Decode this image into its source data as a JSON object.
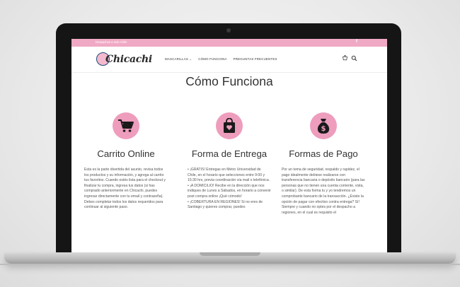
{
  "topbar": {
    "message": "Despachos a todo Chile",
    "social": "f"
  },
  "brand": {
    "name": "Chicachi"
  },
  "nav": {
    "items": [
      {
        "label": "MASCARILLAS ⌄"
      },
      {
        "label": "CÓMO FUNCIONA"
      },
      {
        "label": "PREGUNTAS FRECUENTES"
      }
    ]
  },
  "page": {
    "title": "Cómo Funciona"
  },
  "features": [
    {
      "icon": "shopping-cart-icon",
      "title": "Carrito Online",
      "text": "Esta es la parte divertida del asunto, revisa todos los productos y su información, y agrega al carrito tus favoritos. Cuando estés lista para el checkout y finalizar tu compra, ingresa tus datos (si has comprado anteriormente en Chicachi, puedes ingresar directamente con tu email y contraseña). Debes completar todos los datos requeridos para continuar al siguiente paso."
    },
    {
      "icon": "shopping-bag-heart-icon",
      "title": "Forma de Entrega",
      "items": [
        "¡GRATIS! Entregas en Metro Universidad de Chile, en el horario que selecciones entre 9:00 y 15:30 hrs, previa coordinación vía mail o telefónica.",
        "¡A DOMICILIO! Recibe en la dirección que nos indiques de Lunes a Sábados, en horario a convenir post compra online ¡Qué cómodo!",
        "¡COBERTURA EN REGIONES! Si no eres de Santiago y quieres comprar, puedes"
      ]
    },
    {
      "icon": "money-bag-icon",
      "title": "Formas de Pago",
      "text": "Por un tema de seguridad, respaldo y rapidez, el pago idealmente debiese realizarse con transferencia bancaria o depósito bancario (para las personas que no tienen una cuenta corriente, vista, o similar). De esta forma tu y yo tendremos un comprobante bancario de la transacción. ¿Existe la opción de pagar con efectivo contra entrega? Sí! Siempre y cuando no optes por el despacho a regiones, en el cual es requisito el"
    }
  ],
  "colors": {
    "pink": "#ee9dbd",
    "topbar": "#f0a9c4",
    "text": "#333333"
  }
}
